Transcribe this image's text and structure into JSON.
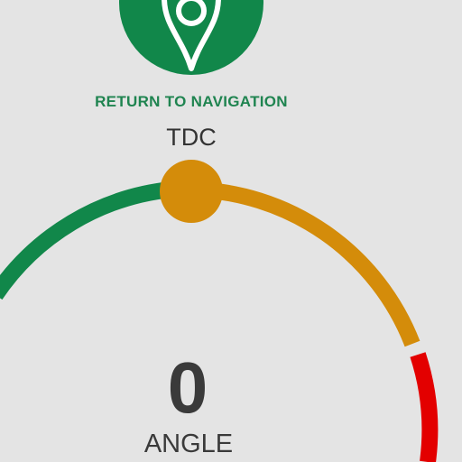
{
  "navigation": {
    "return_label": "RETURN TO NAVIGATION",
    "icon": "map-pin-icon"
  },
  "gauge": {
    "top_label": "TDC",
    "value": "0",
    "value_label": "ANGLE",
    "knob_position_deg": 0,
    "segments": [
      {
        "name": "green",
        "color": "#11874a"
      },
      {
        "name": "amber",
        "color": "#d48c0a"
      },
      {
        "name": "red",
        "color": "#e30000"
      }
    ],
    "knob_color": "#d48c0a"
  }
}
